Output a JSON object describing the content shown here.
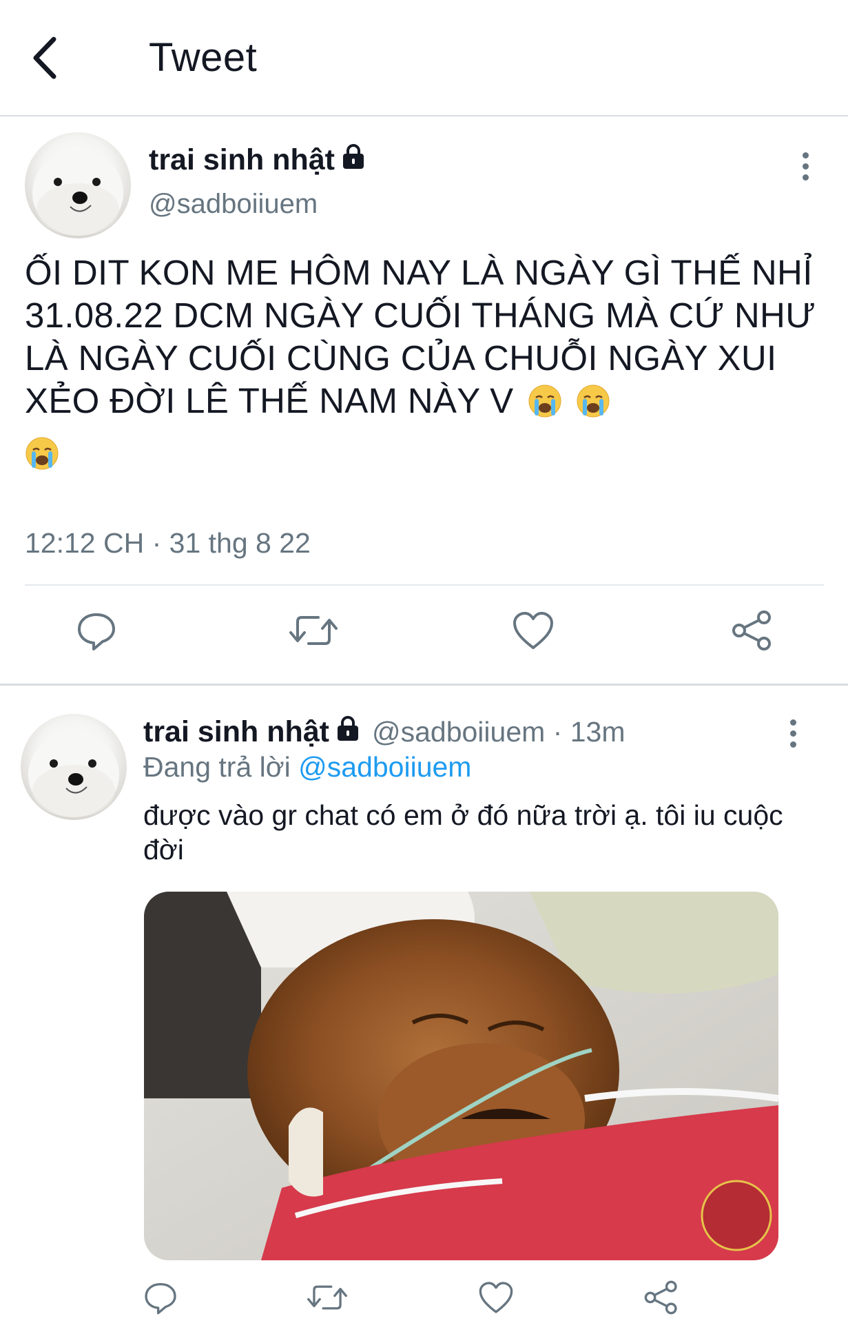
{
  "header": {
    "title": "Tweet"
  },
  "main_tweet": {
    "display_name": "trai sinh nhật",
    "handle": "@sadboiiuem",
    "text": "ỐI DIT KON ME HÔM NAY LÀ NGÀY GÌ THẾ NHỈ 31.08.22 DCM NGÀY CUỐI THÁNG MÀ CỨ NHƯ LÀ NGÀY CUỐI CÙNG CỦA CHUỖI NGÀY XUI XẺO ĐỜI LÊ THẾ NAM NÀY V",
    "emojis": [
      "crying-face",
      "crying-face",
      "crying-face"
    ],
    "timestamp": "12:12 CH · 31 thg 8 22"
  },
  "reply_tweet": {
    "display_name": "trai sinh nhật",
    "handle_time": "@sadboiiuem · 13m",
    "replying_prefix": "Đang trả lời",
    "replying_to": "@sadboiiuem",
    "text": "được vào gr chat có em ở đó nữa trời ạ. tôi iu cuộc đời"
  },
  "icons": {
    "back": "chevron-left-icon",
    "lock": "lock-icon",
    "more": "more-vertical-icon",
    "reply": "reply-icon",
    "retweet": "retweet-icon",
    "like": "heart-icon",
    "share": "share-icon"
  },
  "colors": {
    "text": "#141823",
    "secondary": "#667580",
    "link": "#1d9bf0",
    "divider": "#d8dde1"
  }
}
